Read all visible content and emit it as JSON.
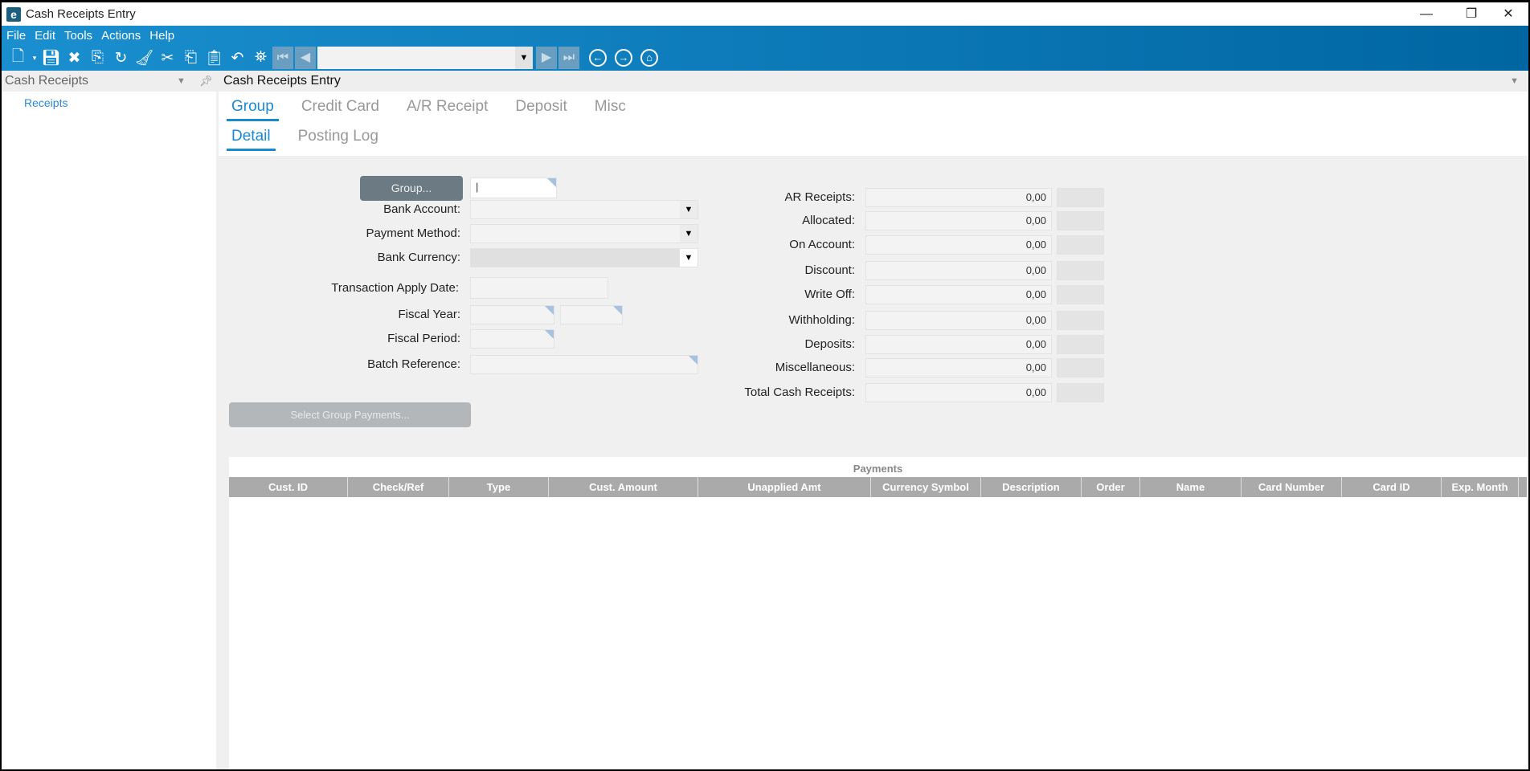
{
  "window": {
    "title": "Cash Receipts Entry",
    "minimize": "—",
    "restore": "❐",
    "close": "✕"
  },
  "menu": [
    "File",
    "Edit",
    "Tools",
    "Actions",
    "Help"
  ],
  "toolbar": {
    "record_select_value": ""
  },
  "left_panel": {
    "title": "Cash Receipts",
    "items": [
      "Receipts"
    ]
  },
  "main": {
    "title": "Cash Receipts Entry",
    "tabs": [
      "Group",
      "Credit Card",
      "A/R Receipt",
      "Deposit",
      "Misc"
    ],
    "subtabs": [
      "Detail",
      "Posting Log"
    ],
    "form": {
      "group_button": "Group...",
      "group_value": "",
      "labels": [
        "Bank Account:",
        "Payment Method:",
        "Bank Currency:",
        "Transaction Apply Date:",
        "Fiscal Year:",
        "Fiscal Period:",
        "Batch Reference:"
      ],
      "select_group_payments": "Select Group Payments..."
    },
    "totals": [
      {
        "label": "AR Receipts:",
        "value": "0,00"
      },
      {
        "label": "Allocated:",
        "value": "0,00"
      },
      {
        "label": "On Account:",
        "value": "0,00"
      },
      {
        "label": "Discount:",
        "value": "0,00"
      },
      {
        "label": "Write Off:",
        "value": "0,00"
      },
      {
        "label": "Withholding:",
        "value": "0,00"
      },
      {
        "label": "Deposits:",
        "value": "0,00"
      },
      {
        "label": "Miscellaneous:",
        "value": "0,00"
      },
      {
        "label": "Total Cash Receipts:",
        "value": "0,00"
      }
    ],
    "payments": {
      "title": "Payments",
      "columns": [
        "Cust. ID",
        "Check/Ref",
        "Type",
        "Cust. Amount",
        "Unapplied Amt",
        "Currency Symbol",
        "Description",
        "Order",
        "Name",
        "Card Number",
        "Card ID",
        "Exp. Month"
      ]
    }
  }
}
